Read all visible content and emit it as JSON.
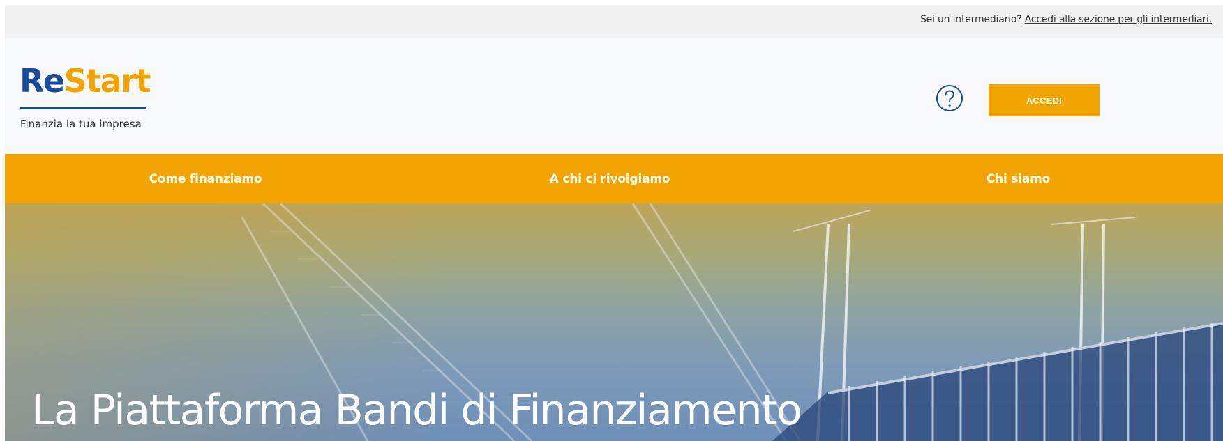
{
  "topbar": {
    "question": "Sei un intermediario? ",
    "link": "Accedi alla sezione per gli intermediari."
  },
  "header": {
    "logo_part1": "Re",
    "logo_part2": "Start",
    "tagline": "Finanzia la tua impresa",
    "help_icon": "question-circle-icon",
    "login_button": "ACCEDI"
  },
  "nav": {
    "items": [
      "Come finanziamo",
      "A chi ci rivolgiamo",
      "Chi siamo"
    ]
  },
  "hero": {
    "title": "La Piattaforma Bandi di Finanziamento"
  },
  "colors": {
    "brand_blue": "#1a4a9a",
    "brand_orange": "#f3a400"
  }
}
